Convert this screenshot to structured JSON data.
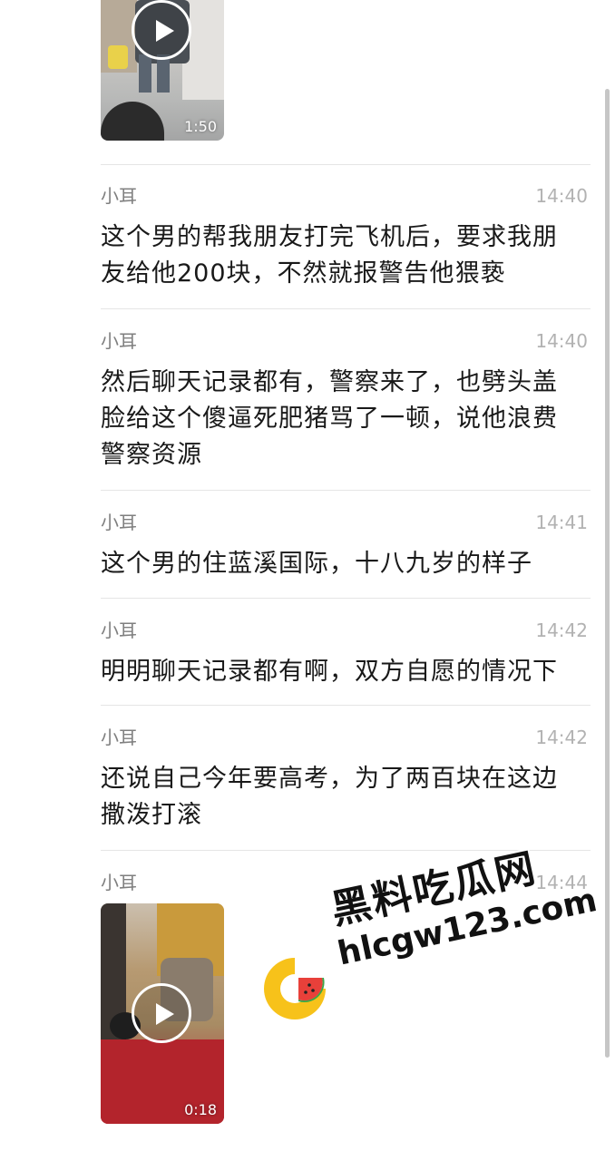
{
  "videos": [
    {
      "duration": "1:50"
    },
    {
      "duration": "0:18"
    }
  ],
  "messages": [
    {
      "sender": "小耳",
      "time": "14:40",
      "text": "这个男的帮我朋友打完飞机后，要求我朋友给他200块，不然就报警告他猥亵"
    },
    {
      "sender": "小耳",
      "time": "14:40",
      "text": "然后聊天记录都有，警察来了，也劈头盖脸给这个傻逼死肥猪骂了一顿，说他浪费警察资源"
    },
    {
      "sender": "小耳",
      "time": "14:41",
      "text": "这个男的住蓝溪国际，十八九岁的样子"
    },
    {
      "sender": "小耳",
      "time": "14:42",
      "text": "明明聊天记录都有啊，双方自愿的情况下"
    },
    {
      "sender": "小耳",
      "time": "14:42",
      "text": "还说自己今年要高考，为了两百块在这边撒泼打滚"
    },
    {
      "sender": "小耳",
      "time": "14:44",
      "text": ""
    }
  ],
  "watermark": {
    "title": "黑料吃瓜网",
    "domain": "hlcgw123.com"
  },
  "colors": {
    "sender": "#7f7f7f",
    "time": "#b2b2b2",
    "text": "#191919",
    "divider": "#e5e5e5",
    "logo_yellow": "#f7c21a",
    "logo_red": "#e8403a",
    "logo_green": "#3aa64a"
  },
  "icons": [
    "play-icon",
    "play-icon",
    "watermark-logo-icon"
  ]
}
